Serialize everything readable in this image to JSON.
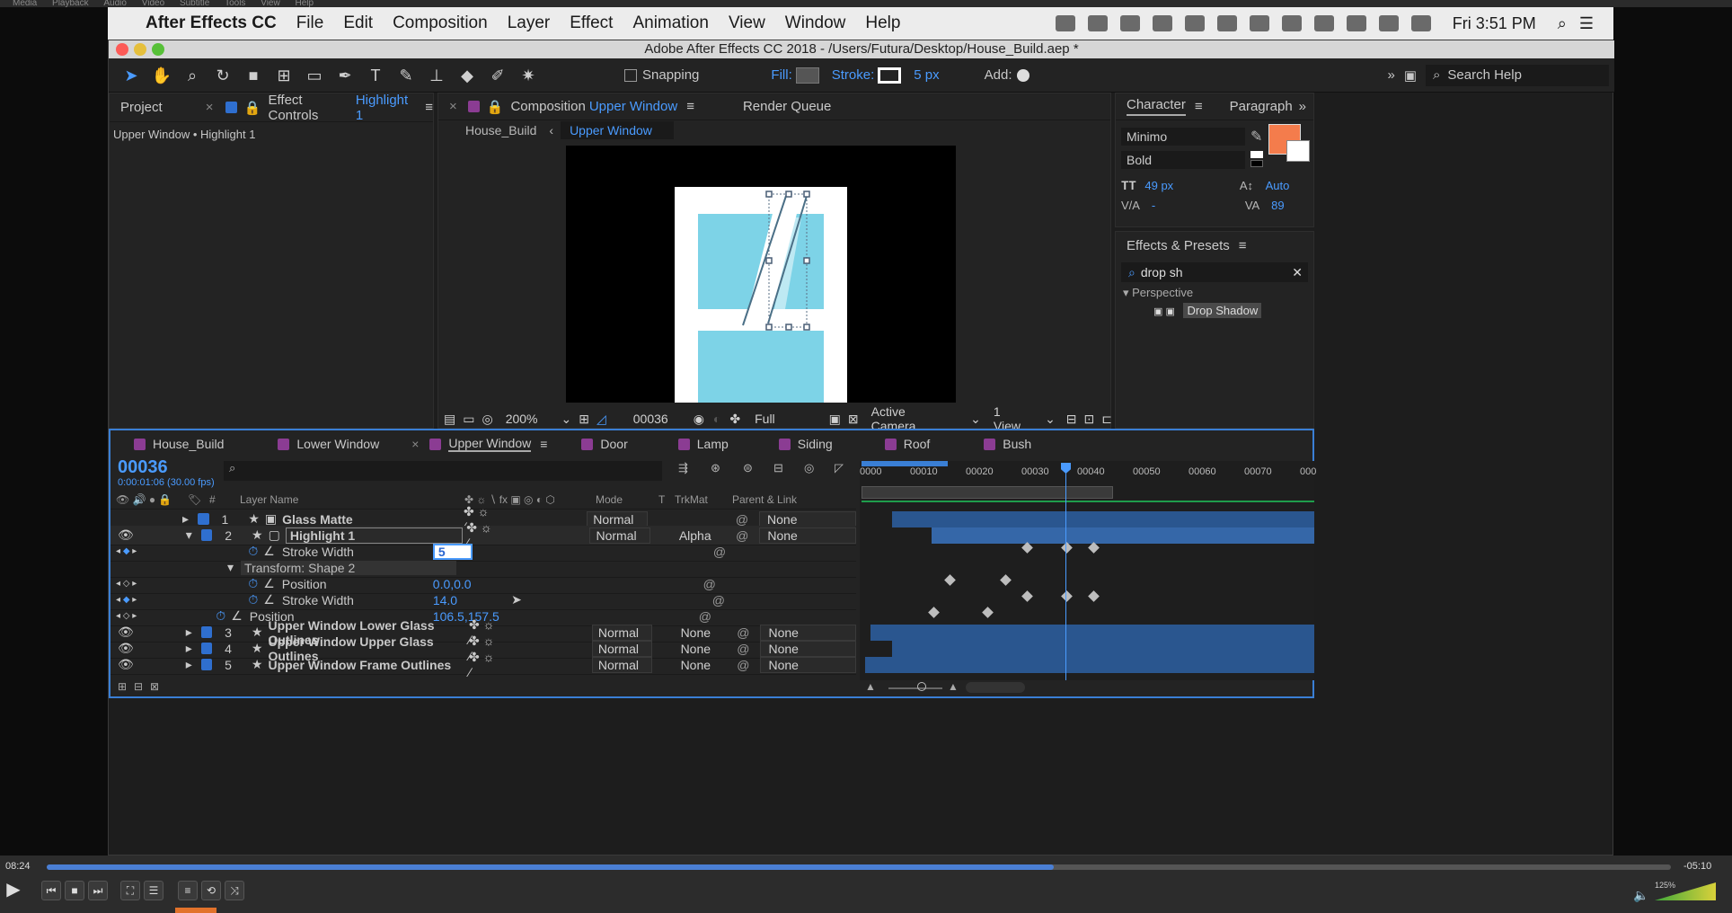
{
  "top_strip": [
    "Media",
    "Playback",
    "Audio",
    "Video",
    "Subtitle",
    "Tools",
    "View",
    "Help"
  ],
  "menubar": {
    "app_name": "After Effects CC",
    "items": [
      "File",
      "Edit",
      "Composition",
      "Layer",
      "Effect",
      "Animation",
      "View",
      "Window",
      "Help"
    ],
    "clock": "Fri 3:51 PM"
  },
  "window": {
    "title": "Adobe After Effects CC 2018 - /Users/Futura/Desktop/House_Build.aep *"
  },
  "toolbar": {
    "snapping": "Snapping",
    "fill": "Fill:",
    "stroke": "Stroke:",
    "stroke_px": "5 px",
    "add": "Add:",
    "search": "Search Help"
  },
  "project_panel": {
    "tab_project": "Project",
    "tab_effect_controls": "Effect Controls",
    "effect_layer": "Highlight 1",
    "subtitle": "Upper Window • Highlight 1"
  },
  "comp_panel": {
    "tab_prefix": "Composition",
    "tab_name": "Upper Window",
    "tab_render": "Render Queue",
    "crumb_parent": "House_Build",
    "crumb_current": "Upper Window",
    "zoom": "200%",
    "timecode": "00036",
    "resolution": "Full",
    "camera": "Active Camera",
    "views": "1 View"
  },
  "character_panel": {
    "tab_character": "Character",
    "tab_paragraph": "Paragraph",
    "font": "Minimo",
    "style": "Bold",
    "size": "49 px",
    "leading": "Auto",
    "kerning": "-",
    "tracking": "89",
    "fill_color": "#f47c4c"
  },
  "effects_panel": {
    "title": "Effects & Presets",
    "search": "drop sh",
    "category": "Perspective",
    "item": "Drop Shadow"
  },
  "timeline": {
    "tabs": [
      {
        "name": "House_Build",
        "color": "#8b3c93"
      },
      {
        "name": "Lower Window",
        "color": "#8b3c93"
      },
      {
        "name": "Upper Window",
        "color": "#8b3c93",
        "active": true
      },
      {
        "name": "Door",
        "color": "#8b3c93"
      },
      {
        "name": "Lamp",
        "color": "#8b3c93"
      },
      {
        "name": "Siding",
        "color": "#8b3c93"
      },
      {
        "name": "Roof",
        "color": "#8b3c93"
      },
      {
        "name": "Bush",
        "color": "#8b3c93"
      }
    ],
    "current_time": "00036",
    "current_time_sub": "0:00:01:06 (30.00 fps)",
    "col_layer_name": "Layer Name",
    "col_num": "#",
    "col_mode": "Mode",
    "col_t": "T",
    "col_trkmat": "TrkMat",
    "col_parent": "Parent & Link",
    "ruler": [
      "0000",
      "00010",
      "00020",
      "00030",
      "00040",
      "00050",
      "00060",
      "00070",
      "000"
    ],
    "layers": [
      {
        "num": "1",
        "name": "Glass Matte",
        "mode": "Normal",
        "trkmat": "",
        "parent": "None"
      },
      {
        "num": "2",
        "name": "Highlight 1",
        "mode": "Normal",
        "trkmat": "Alpha",
        "parent": "None"
      },
      {
        "num": "3",
        "name": "Upper Window Lower Glass Outlines",
        "mode": "Normal",
        "trkmat": "None",
        "parent": "None"
      },
      {
        "num": "4",
        "name": "Upper Window Upper Glass Outlines",
        "mode": "Normal",
        "trkmat": "None",
        "parent": "None"
      },
      {
        "num": "5",
        "name": "Upper Window Frame Outlines",
        "mode": "Normal",
        "trkmat": "None",
        "parent": "None"
      }
    ],
    "props": {
      "stroke_width_label": "Stroke Width",
      "stroke_width_value": "5",
      "transform_label": "Transform: Shape 2",
      "position_label": "Position",
      "position_value": "0.0,0.0",
      "stroke_width2_label": "Stroke Width",
      "stroke_width2_value": "14.0",
      "layer_position_label": "Position",
      "layer_position_value": "106.5,157.5"
    }
  },
  "player": {
    "elapsed": "08:24",
    "remaining": "-05:10",
    "volume": "125%",
    "progress": 0.62
  }
}
